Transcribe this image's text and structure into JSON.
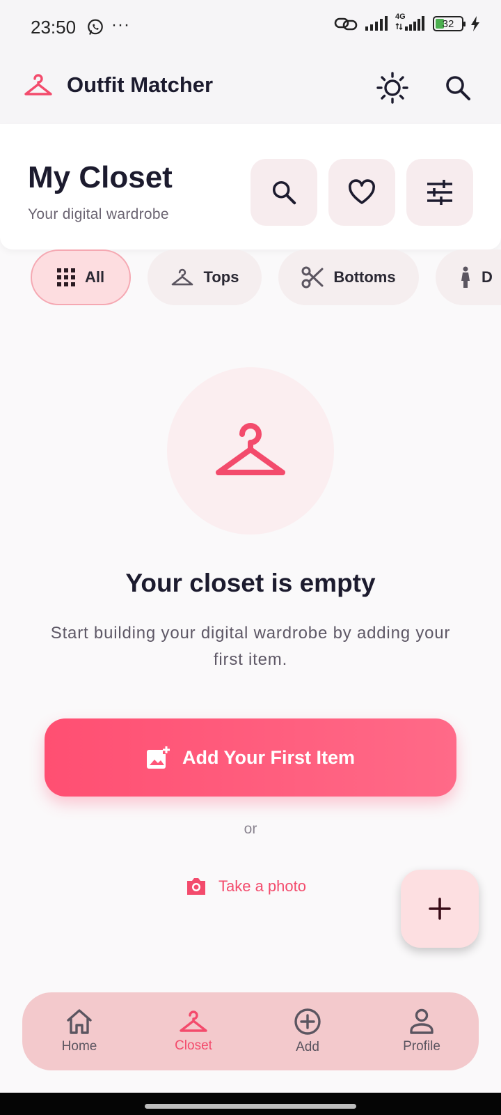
{
  "status_bar": {
    "time": "23:50",
    "more": "···",
    "network_label": "4G",
    "battery_level": "32",
    "icons": [
      "whatsapp-icon",
      "link-icon",
      "signal-icon",
      "signal-4g-icon",
      "battery-icon",
      "charging-icon"
    ]
  },
  "app_bar": {
    "title": "Outfit Matcher",
    "icons": [
      "hanger-icon",
      "brightness-icon",
      "search-icon"
    ]
  },
  "header": {
    "title": "My Closet",
    "subtitle": "Your digital wardrobe",
    "actions": [
      "search-icon",
      "heart-icon",
      "tune-icon"
    ]
  },
  "categories": [
    {
      "label": "All",
      "icon": "grid-icon",
      "selected": true
    },
    {
      "label": "Tops",
      "icon": "hanger-icon",
      "selected": false
    },
    {
      "label": "Bottoms",
      "icon": "scissors-icon",
      "selected": false
    },
    {
      "label": "D",
      "icon": "dress-icon",
      "selected": false
    }
  ],
  "empty_state": {
    "title": "Your closet is empty",
    "description": "Start building your digital wardrobe by adding your first item.",
    "primary_button": "Add Your First Item",
    "or_text": "or",
    "secondary_link": "Take a photo"
  },
  "fab": {
    "icon": "plus-icon"
  },
  "bottom_nav": {
    "items": [
      {
        "label": "Home",
        "icon": "home-icon",
        "active": false
      },
      {
        "label": "Closet",
        "icon": "hanger-icon",
        "active": true
      },
      {
        "label": "Add",
        "icon": "add-circle-icon",
        "active": false
      },
      {
        "label": "Profile",
        "icon": "person-icon",
        "active": false
      }
    ]
  },
  "colors": {
    "accent": "#f34b6c",
    "chip_active_bg": "#fddde0",
    "bottom_nav_bg": "#f3c9cc",
    "text_primary": "#1c1b2e"
  }
}
